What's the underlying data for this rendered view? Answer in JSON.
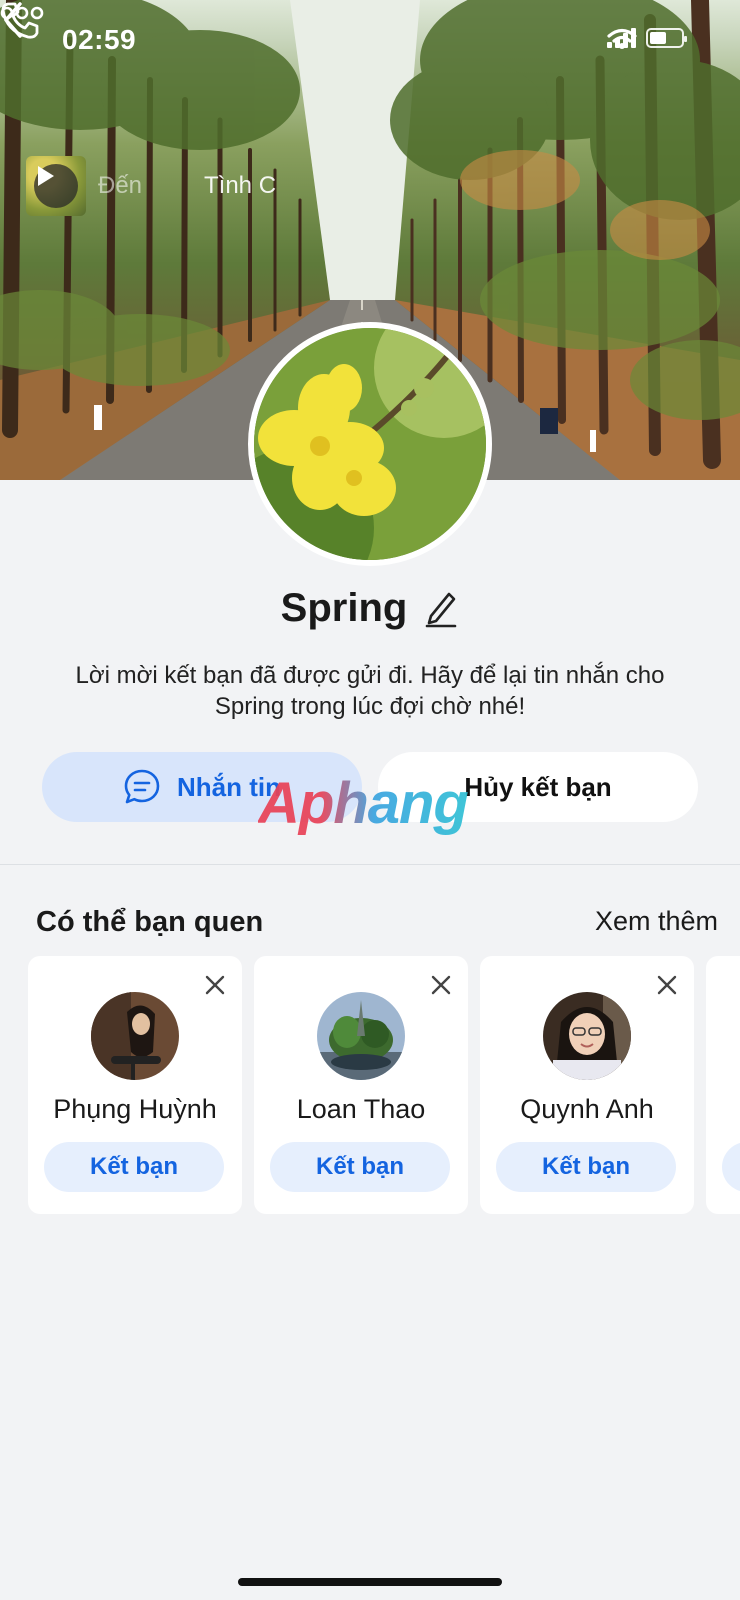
{
  "status_bar": {
    "time": "02:59"
  },
  "music": {
    "title": "Đến",
    "artist": "Tình C"
  },
  "profile": {
    "name": "Spring",
    "message": "Lời mời kết bạn đã được gửi đi. Hãy để lại tin nhắn cho Spring trong lúc đợi chờ nhé!"
  },
  "actions": {
    "message_label": "Nhắn tin",
    "cancel_label": "Hủy kết bạn"
  },
  "watermark": "Aphang",
  "suggestions": {
    "title": "Có thể bạn quen",
    "see_more": "Xem thêm",
    "items": [
      {
        "name": "Phụng Huỳnh",
        "button": "Kết bạn"
      },
      {
        "name": "Loan Thao",
        "button": "Kết bạn"
      },
      {
        "name": "Quynh Anh",
        "button": "Kết bạn"
      }
    ]
  },
  "colors": {
    "accent": "#1464e0",
    "accent_soft": "#d8e5fb",
    "background": "#f2f3f5"
  }
}
